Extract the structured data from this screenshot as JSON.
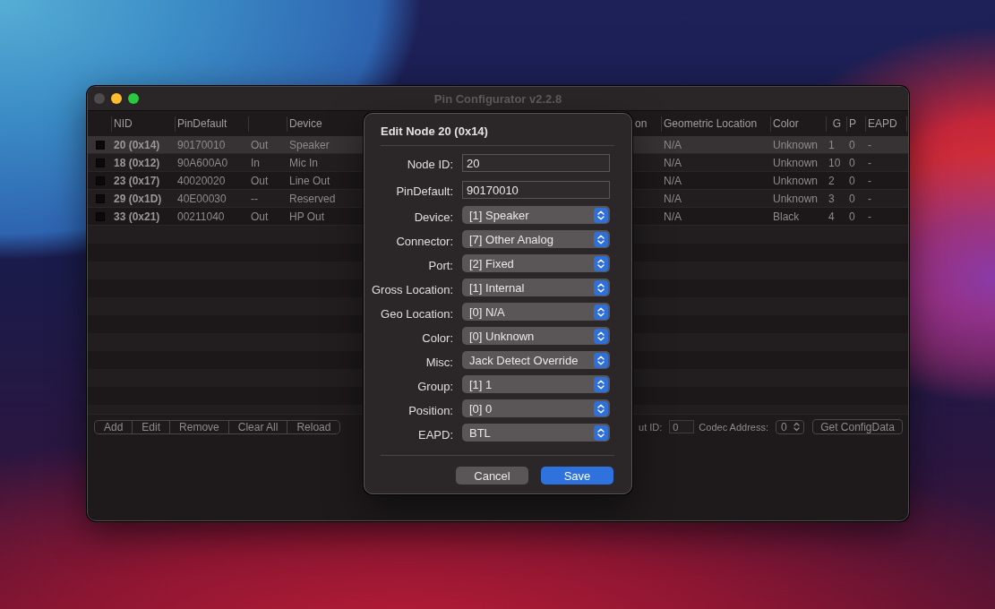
{
  "window": {
    "title": "Pin Configurator v2.2.8",
    "controls": [
      {
        "kind": "close",
        "disabled": true
      },
      {
        "kind": "minimize",
        "disabled": false
      },
      {
        "kind": "zoom",
        "disabled": false
      }
    ]
  },
  "table": {
    "columns": [
      "NID",
      "PinDefault",
      "Device",
      "on",
      "Geometric Location",
      "Color",
      "G",
      "P",
      "EAPD"
    ],
    "rows": [
      {
        "selected": true,
        "nid": "20 (0x14)",
        "pin_default": "90170010",
        "direction": "Out",
        "device": "Speaker",
        "geometric_location": "N/A",
        "color_name": "Unknown",
        "g": "1",
        "p": "0",
        "eapd": "-"
      },
      {
        "selected": false,
        "nid": "18 (0x12)",
        "pin_default": "90A600A0",
        "direction": "In",
        "device": "Mic In",
        "geometric_location": "N/A",
        "color_name": "Unknown",
        "g": "10",
        "p": "0",
        "eapd": "-"
      },
      {
        "selected": false,
        "nid": "23 (0x17)",
        "pin_default": "40020020",
        "direction": "Out",
        "device": "Line Out",
        "geometric_location": "N/A",
        "color_name": "Unknown",
        "g": "2",
        "p": "0",
        "eapd": "-"
      },
      {
        "selected": false,
        "nid": "29 (0x1D)",
        "pin_default": "40E00030",
        "direction": "--",
        "device": "Reserved",
        "geometric_location": "N/A",
        "color_name": "Unknown",
        "g": "3",
        "p": "0",
        "eapd": "-"
      },
      {
        "selected": false,
        "nid": "33 (0x21)",
        "pin_default": "00211040",
        "direction": "Out",
        "device": "HP Out",
        "geometric_location": "N/A",
        "color_name": "Black",
        "g": "4",
        "p": "0",
        "eapd": "-"
      }
    ]
  },
  "toolbar": {
    "buttons": [
      "Add",
      "Edit",
      "Remove",
      "Clear All",
      "Reload"
    ],
    "id_field": {
      "label": "ut ID:",
      "value": "0"
    },
    "codec_address": {
      "label": "Codec Address:",
      "value": "0"
    },
    "config_button": "Get ConfigData"
  },
  "dialog": {
    "title": "Edit Node 20 (0x14)",
    "fields": [
      {
        "kind": "text",
        "label": "Node ID:",
        "value": "20"
      },
      {
        "kind": "text",
        "label": "PinDefault:",
        "value": "90170010"
      },
      {
        "kind": "popup",
        "label": "Device:",
        "value": "[1] Speaker"
      },
      {
        "kind": "popup",
        "label": "Connector:",
        "value": "[7] Other Analog"
      },
      {
        "kind": "popup",
        "label": "Port:",
        "value": "[2] Fixed"
      },
      {
        "kind": "popup",
        "label": "Gross Location:",
        "value": "[1] Internal"
      },
      {
        "kind": "popup",
        "label": "Geo Location:",
        "value": "[0] N/A"
      },
      {
        "kind": "popup",
        "label": "Color:",
        "value": "[0] Unknown"
      },
      {
        "kind": "popup",
        "label": "Misc:",
        "value": "Jack Detect Override"
      },
      {
        "kind": "popup",
        "label": "Group:",
        "value": "[1] 1"
      },
      {
        "kind": "popup",
        "label": "Position:",
        "value": "[0] 0"
      },
      {
        "kind": "popup",
        "label": "EAPD:",
        "value": "BTL"
      }
    ],
    "buttons": [
      {
        "kind": "cancel",
        "label": "Cancel"
      },
      {
        "kind": "confirm",
        "label": "Save"
      }
    ]
  }
}
